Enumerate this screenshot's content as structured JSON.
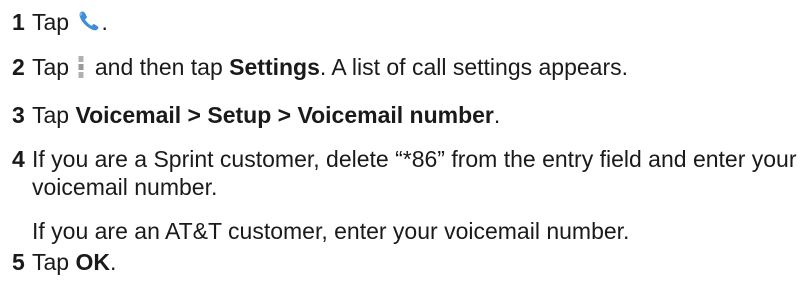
{
  "icons": {
    "phone": "phone-icon",
    "menu": "menu-overflow-icon"
  },
  "colors": {
    "phone_icon": "#3d8fd8",
    "menu_icon": "#9a9a9a",
    "text": "#1a1a1a"
  },
  "steps": [
    {
      "number": "1",
      "before": "Tap",
      "after": "."
    },
    {
      "number": "2",
      "before": "Tap",
      "middle": "and then tap",
      "bold": "Settings",
      "after": ". A list of call settings appears."
    },
    {
      "number": "3",
      "before": "Tap",
      "bold": "Voicemail > Setup > Voicemail number",
      "after": "."
    },
    {
      "number": "4",
      "text": "If you are a Sprint customer, delete “*86” from the entry field and enter your voicemail number.",
      "note": "If you are an AT&T customer, enter your voicemail number."
    },
    {
      "number": "5",
      "before": "Tap",
      "bold": "OK",
      "after": "."
    }
  ]
}
